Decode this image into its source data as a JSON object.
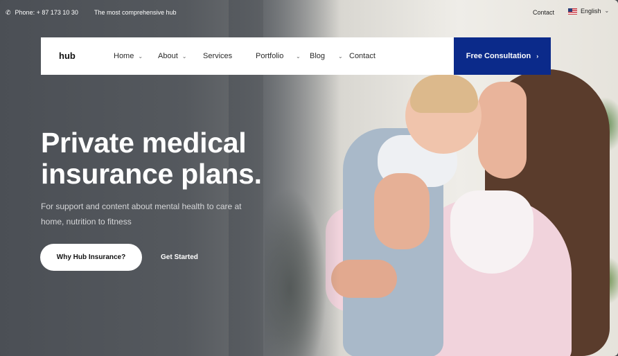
{
  "topbar": {
    "phone_icon": "phone-icon",
    "phone": "Phone: + 87 173 10 30",
    "tagline": "The most comprehensive hub",
    "contact": "Contact",
    "language": "English"
  },
  "navbar": {
    "logo": "hub",
    "items": [
      {
        "label": "Home",
        "has_dropdown": true
      },
      {
        "label": "About",
        "has_dropdown": true
      },
      {
        "label": "Services",
        "has_dropdown": false
      },
      {
        "label": "Portfolio",
        "has_dropdown": true
      },
      {
        "label": "Blog",
        "has_dropdown": true
      },
      {
        "label": "Contact",
        "has_dropdown": false
      }
    ],
    "cta": "Free Consultation",
    "cta_color": "#0b2a8a"
  },
  "hero": {
    "title_line1": "Private medical",
    "title_line2": "insurance plans.",
    "subtitle": "For support and content about mental health to care at home, nutrition to fitness",
    "primary_button": "Why Hub Insurance?",
    "secondary_link": "Get Started"
  }
}
